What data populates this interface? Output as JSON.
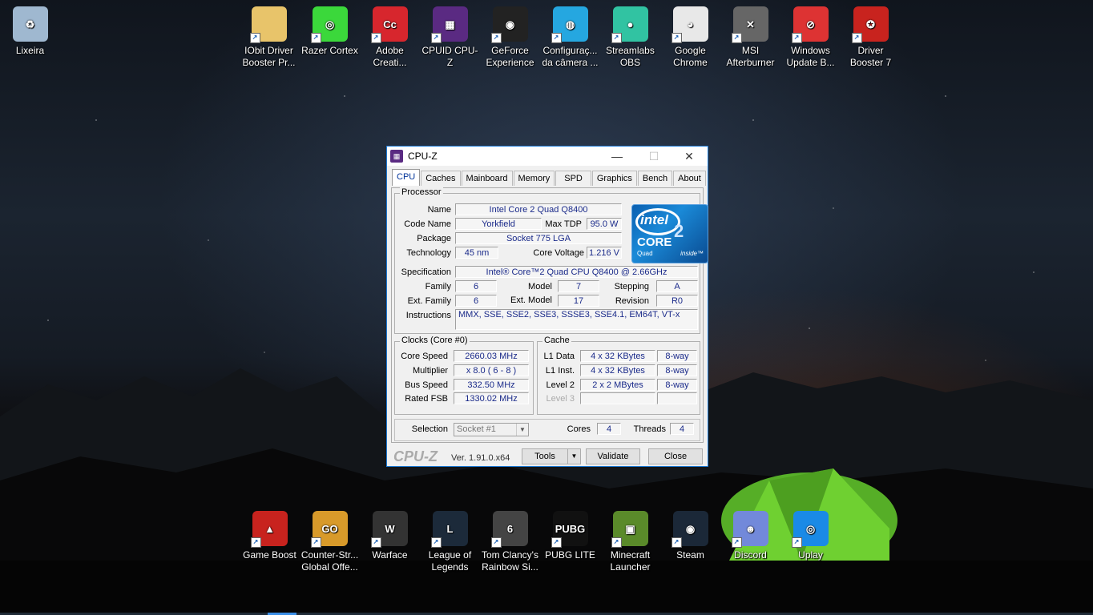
{
  "desktop": {
    "top_icons": [
      {
        "name": "recycle-bin",
        "label": "Lixeira",
        "color": "#9fb8d0",
        "glyph": "♻"
      },
      {
        "name": "iobit-driver-booster",
        "label": "IObit Driver Booster Pr...",
        "color": "#e8c46a",
        "glyph": ""
      },
      {
        "name": "razer-cortex",
        "label": "Razer Cortex",
        "color": "#3bd83b",
        "glyph": "◎"
      },
      {
        "name": "adobe-creative",
        "label": "Adobe Creati...",
        "color": "#d7262d",
        "glyph": "Cc"
      },
      {
        "name": "cpuid-cpuz",
        "label": "CPUID CPU-Z",
        "color": "#5a2a82",
        "glyph": "▦"
      },
      {
        "name": "geforce-experience",
        "label": "GeForce Experience",
        "color": "#222",
        "glyph": "◉"
      },
      {
        "name": "camera-config",
        "label": "Configuraç... da câmera ...",
        "color": "#25a7e0",
        "glyph": "◍"
      },
      {
        "name": "streamlabs-obs",
        "label": "Streamlabs OBS",
        "color": "#31c3a2",
        "glyph": "●"
      },
      {
        "name": "google-chrome",
        "label": "Google Chrome",
        "color": "#e8e8e8",
        "glyph": "◕"
      },
      {
        "name": "msi-afterburner",
        "label": "MSI Afterburner",
        "color": "#666",
        "glyph": "✕"
      },
      {
        "name": "windows-update-blocker",
        "label": "Windows Update B...",
        "color": "#d33",
        "glyph": "⊘"
      },
      {
        "name": "driver-booster-7",
        "label": "Driver Booster 7",
        "color": "#c8231e",
        "glyph": "✪"
      }
    ],
    "bottom_icons": [
      {
        "name": "game-boost",
        "label": "Game Boost",
        "color": "#c8231e",
        "glyph": "▲"
      },
      {
        "name": "counter-strike",
        "label": "Counter-Str... Global Offe...",
        "color": "#d89a2a",
        "glyph": "GO"
      },
      {
        "name": "warface",
        "label": "Warface",
        "color": "#333",
        "glyph": "W"
      },
      {
        "name": "league-of-legends",
        "label": "League of Legends",
        "color": "#1c2a3a",
        "glyph": "L"
      },
      {
        "name": "rainbow-six",
        "label": "Tom Clancy's Rainbow Si...",
        "color": "#444",
        "glyph": "6"
      },
      {
        "name": "pubg-lite",
        "label": "PUBG LITE",
        "color": "#111",
        "glyph": "PUBG"
      },
      {
        "name": "minecraft-launcher",
        "label": "Minecraft Launcher",
        "color": "#5a8a2a",
        "glyph": "▣"
      },
      {
        "name": "steam",
        "label": "Steam",
        "color": "#1b2838",
        "glyph": "◉"
      },
      {
        "name": "discord",
        "label": "Discord",
        "color": "#7289da",
        "glyph": "☻"
      },
      {
        "name": "uplay",
        "label": "Uplay",
        "color": "#1a8ae6",
        "glyph": "◎"
      }
    ]
  },
  "window": {
    "title": "CPU-Z",
    "minimize": "—",
    "maximize": "☐",
    "close": "✕",
    "tabs": [
      "CPU",
      "Caches",
      "Mainboard",
      "Memory",
      "SPD",
      "Graphics",
      "Bench",
      "About"
    ],
    "active_tab": "CPU"
  },
  "processor": {
    "legend": "Processor",
    "name_label": "Name",
    "name": "Intel Core 2 Quad Q8400",
    "codename_label": "Code Name",
    "codename": "Yorkfield",
    "maxtdp_label": "Max TDP",
    "maxtdp": "95.0 W",
    "package_label": "Package",
    "package": "Socket 775 LGA",
    "technology_label": "Technology",
    "technology": "45 nm",
    "corevoltage_label": "Core Voltage",
    "corevoltage": "1.216 V",
    "spec_label": "Specification",
    "spec": "Intel® Core™2 Quad CPU    Q8400  @ 2.66GHz",
    "family_label": "Family",
    "family": "6",
    "model_label": "Model",
    "model": "7",
    "stepping_label": "Stepping",
    "stepping": "A",
    "extfamily_label": "Ext. Family",
    "extfamily": "6",
    "extmodel_label": "Ext. Model",
    "extmodel": "17",
    "revision_label": "Revision",
    "revision": "R0",
    "instructions_label": "Instructions",
    "instructions": "MMX, SSE, SSE2, SSE3, SSSE3, SSE4.1, EM64T, VT-x",
    "logo": {
      "intel": "intel",
      "core": "CORE",
      "two": "2",
      "quad": "Quad",
      "inside": "inside™"
    }
  },
  "clocks": {
    "legend": "Clocks (Core #0)",
    "corespeed_label": "Core Speed",
    "corespeed": "2660.03 MHz",
    "multiplier_label": "Multiplier",
    "multiplier": "x 8.0 ( 6 - 8 )",
    "busspeed_label": "Bus Speed",
    "busspeed": "332.50 MHz",
    "ratedfsb_label": "Rated FSB",
    "ratedfsb": "1330.02 MHz"
  },
  "cache": {
    "legend": "Cache",
    "l1data_label": "L1 Data",
    "l1data": "4 x 32 KBytes",
    "l1data_way": "8-way",
    "l1inst_label": "L1 Inst.",
    "l1inst": "4 x 32 KBytes",
    "l1inst_way": "8-way",
    "level2_label": "Level 2",
    "level2": "2 x 2 MBytes",
    "level2_way": "8-way",
    "level3_label": "Level 3"
  },
  "selection": {
    "label": "Selection",
    "value": "Socket #1",
    "cores_label": "Cores",
    "cores": "4",
    "threads_label": "Threads",
    "threads": "4"
  },
  "footer": {
    "brand": "CPU-Z",
    "version": "Ver. 1.91.0.x64",
    "tools": "Tools",
    "validate": "Validate",
    "close": "Close"
  }
}
